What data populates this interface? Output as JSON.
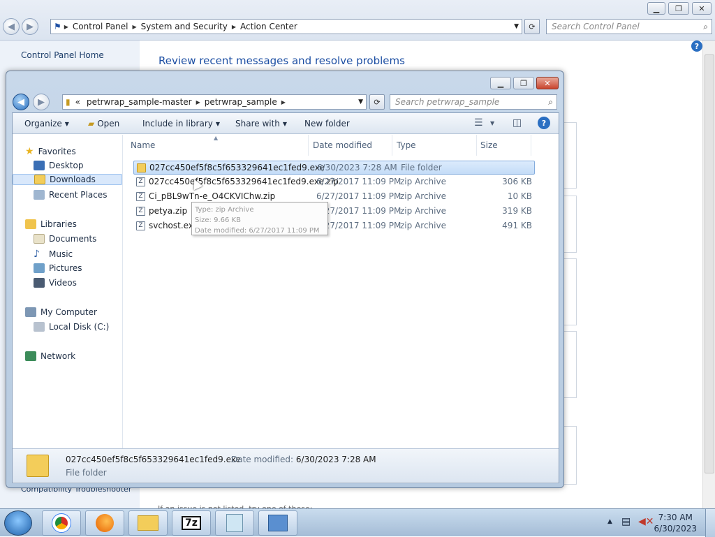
{
  "control_panel": {
    "breadcrumbs": [
      "Control Panel",
      "System and Security",
      "Action Center"
    ],
    "search_placeholder": "Search Control Panel",
    "sidebar_home": "Control Panel Home",
    "sidebar_bottom": "Compatibility Troubleshooter",
    "page_title": "Review recent messages and resolve problems",
    "bottom_text": "If an issue is not listed, try one of these:"
  },
  "explorer": {
    "breadcrumbs": [
      "petrwrap_sample-master",
      "petrwrap_sample"
    ],
    "overflow_glyph": "«",
    "search_placeholder": "Search petrwrap_sample",
    "toolbar": {
      "organize": "Organize",
      "open": "Open",
      "include_in_library": "Include in library",
      "share_with": "Share with",
      "new_folder": "New folder"
    },
    "nav": {
      "favorites": "Favorites",
      "desktop": "Desktop",
      "downloads": "Downloads",
      "recent_places": "Recent Places",
      "libraries": "Libraries",
      "documents": "Documents",
      "music": "Music",
      "pictures": "Pictures",
      "videos": "Videos",
      "my_computer": "My Computer",
      "local_disk": "Local Disk (C:)",
      "network": "Network"
    },
    "columns": {
      "name": "Name",
      "date": "Date modified",
      "type": "Type",
      "size": "Size"
    },
    "files": [
      {
        "name": "027cc450ef5f8c5f653329641ec1fed9.exe",
        "date": "6/30/2023 7:28 AM",
        "type": "File folder",
        "size": ""
      },
      {
        "name": "027cc450ef5f8c5f653329641ec1fed9.exe.zip",
        "date": "6/27/2017 11:09 PM",
        "type": "zip Archive",
        "size": "306 KB"
      },
      {
        "name": "Ci_pBL9wTn-e_O4CKVIChw.zip",
        "date": "6/27/2017 11:09 PM",
        "type": "zip Archive",
        "size": "10 KB"
      },
      {
        "name": "petya.zip",
        "date": "6/27/2017 11:09 PM",
        "type": "zip Archive",
        "size": "319 KB"
      },
      {
        "name": "svchost.exe.zip",
        "date": "6/27/2017 11:09 PM",
        "type": "zip Archive",
        "size": "491 KB"
      }
    ],
    "tooltip": {
      "type": "Type: zip Archive",
      "size": "Size: 9.66 KB",
      "date": "Date modified: 6/27/2017 11:09 PM"
    },
    "details": {
      "name": "027cc450ef5f8c5f653329641ec1fed9.exe",
      "date_label": "Date modified:",
      "date_value": "6/30/2023 7:28 AM",
      "type": "File folder"
    }
  },
  "taskbar": {
    "sevenzip_label": "7z",
    "time": "7:30 AM",
    "date": "6/30/2023"
  }
}
